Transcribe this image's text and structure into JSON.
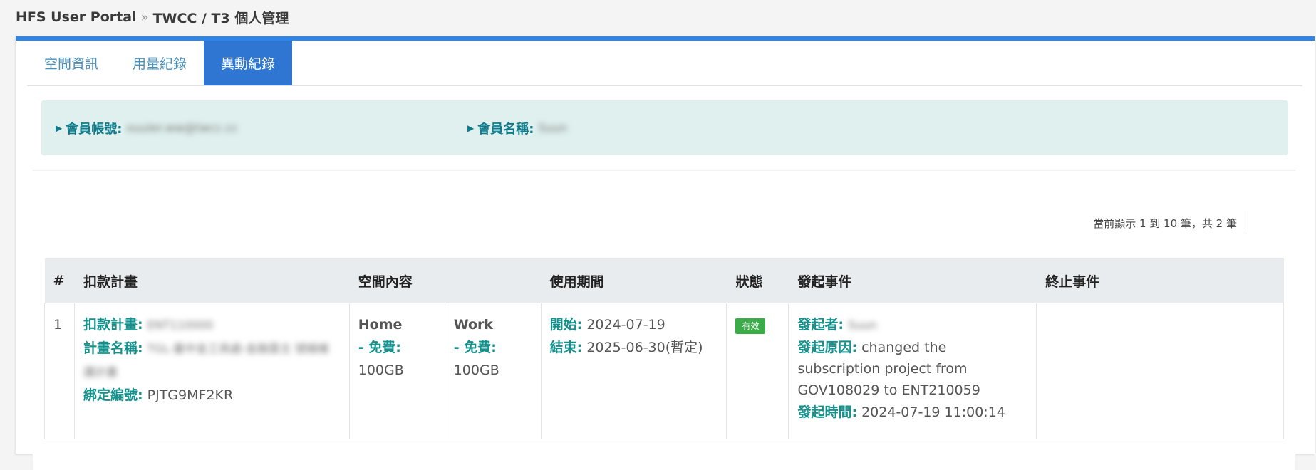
{
  "breadcrumb": {
    "portal": "HFS User Portal",
    "separator": "»",
    "current": "TWCC / T3 個人管理"
  },
  "tabs": [
    {
      "label": "空間資訊",
      "active": false
    },
    {
      "label": "用量紀錄",
      "active": false
    },
    {
      "label": "異動紀錄",
      "active": true
    }
  ],
  "member": {
    "account_label": "會員帳號:",
    "account_value": "ouuler.ww@twcc.cc",
    "name_label": "會員名稱:",
    "name_value": "Suun"
  },
  "pager": {
    "info": "當前顯示 1 到 10 筆，共 2 筆"
  },
  "table": {
    "headers": [
      "#",
      "扣款計畫",
      "空間內容",
      "",
      "使用期間",
      "狀態",
      "發起事件",
      "終止事件"
    ],
    "rows": [
      {
        "index": "1",
        "plan_label": "扣款計畫:",
        "plan_value": "ENT110000",
        "plan_name_label": "計畫名稱:",
        "plan_name_value": "TGL-量中金工商處-金融雲主 號線維護計畫",
        "bind_label": "綁定編號:",
        "bind_value": "PJTG9MF2KR",
        "space_home": {
          "name": "Home",
          "free_label": "- 免費:",
          "size": "100GB"
        },
        "space_work": {
          "name": "Work",
          "free_label": "- 免費:",
          "size": "100GB"
        },
        "start_label": "開始:",
        "start_value": "2024-07-19",
        "end_label": "結束:",
        "end_value": "2025-06-30(暫定)",
        "status": "有效",
        "initiator_label": "發起者:",
        "initiator_value": "Suun",
        "reason_label": "發起原因:",
        "reason_value": "changed the subscription project from GOV108029 to ENT210059",
        "time_label": "發起時間:",
        "time_value": "2024-07-19 11:00:14",
        "terminate": ""
      }
    ]
  },
  "colors": {
    "accent": "#2e86e8",
    "tab_active": "#2e76d1",
    "label_teal": "#14918c",
    "info_bg": "#dff0ee",
    "status_green": "#3cab4a"
  }
}
